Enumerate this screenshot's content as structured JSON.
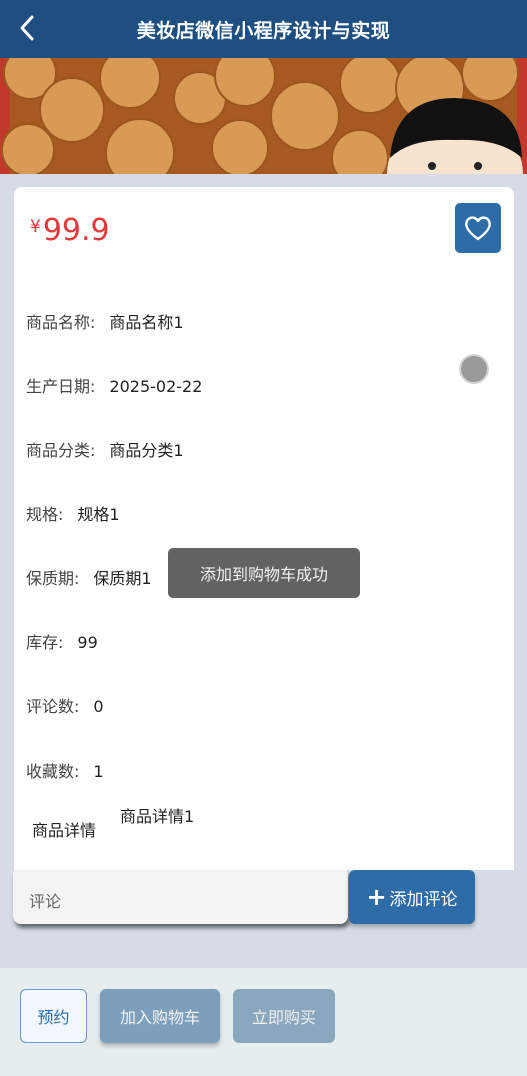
{
  "header": {
    "title": "美妆店微信小程序设计与实现",
    "back_icon": "chevron-left-icon"
  },
  "product": {
    "currency": "¥",
    "price": "99.9",
    "favorite_icon": "heart-icon",
    "details": [
      {
        "label": "商品名称:",
        "value": "商品名称1"
      },
      {
        "label": "生产日期:",
        "value": "2025-02-22"
      },
      {
        "label": "商品分类:",
        "value": "商品分类1"
      },
      {
        "label": "规格:",
        "value": "规格1"
      },
      {
        "label": "保质期:",
        "value": "保质期1"
      },
      {
        "label": "库存:",
        "value": "99"
      },
      {
        "label": "评论数:",
        "value": "0"
      },
      {
        "label": "收藏数:",
        "value": "1"
      }
    ],
    "description_label": "商品详情",
    "description_value": "商品详情1"
  },
  "toast": {
    "message": "添加到购物车成功"
  },
  "comment": {
    "placeholder": "评论",
    "add_button_label": "添加评论",
    "add_button_icon": "plus-icon"
  },
  "actions": {
    "reserve_label": "预约",
    "cart_label": "加入购物车",
    "buy_label": "立即购买"
  },
  "colors": {
    "header": "#1e4f80",
    "primary": "#2d6ca6",
    "price": "#e4393c"
  }
}
